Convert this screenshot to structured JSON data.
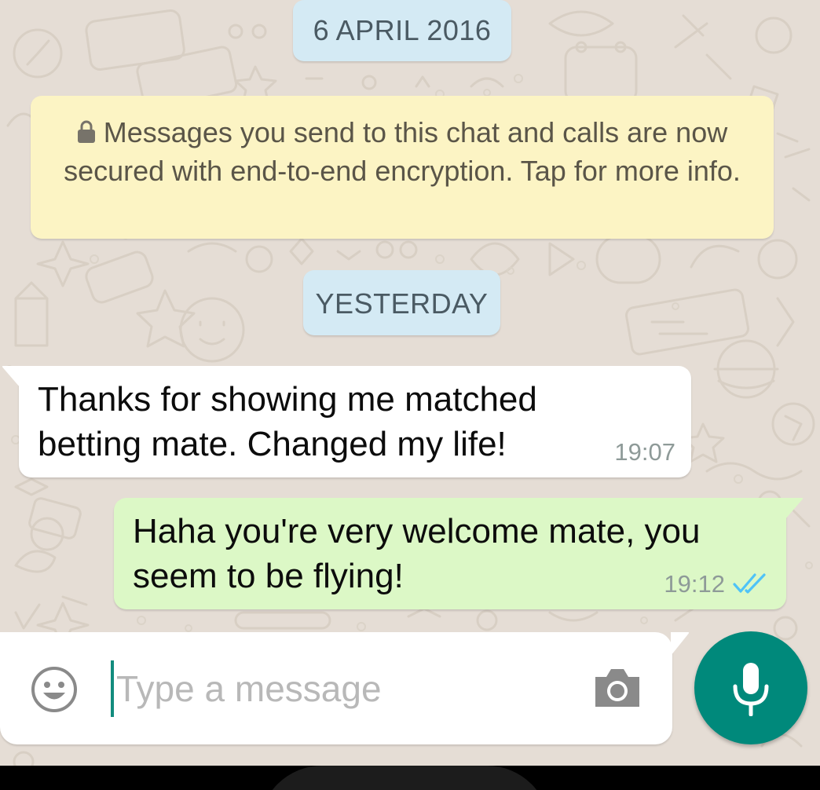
{
  "chat": {
    "date_chip_1": "6 APRIL 2016",
    "encryption_notice": "Messages you send to this chat and calls are now secured with end-to-end encryption. Tap for more info.",
    "date_chip_2": "YESTERDAY",
    "messages": [
      {
        "direction": "incoming",
        "text": "Thanks for showing me matched betting mate. Changed my life!",
        "time": "19:07"
      },
      {
        "direction": "outgoing",
        "text": "Haha you're very welcome mate, you seem to be flying!",
        "time": "19:12",
        "status_icon": "double-tick-read-icon"
      }
    ]
  },
  "composer": {
    "placeholder": "Type a message",
    "value": "",
    "icons": [
      "emoji-icon",
      "camera-icon",
      "mic-icon"
    ]
  },
  "colors": {
    "wallpaper": "#e5ddd5",
    "outgoing_bubble": "#dcf8c6",
    "incoming_bubble": "#ffffff",
    "notice_bubble": "#fcf4c4",
    "date_chip": "#d4eaf4",
    "accent": "#00897b",
    "read_ticks": "#4fc3f7"
  }
}
